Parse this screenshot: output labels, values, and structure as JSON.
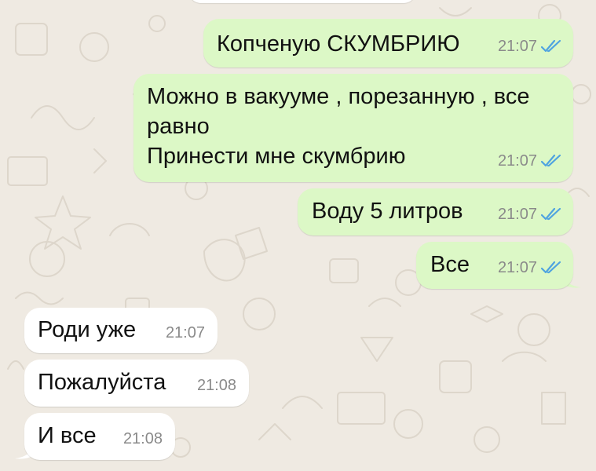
{
  "chat": {
    "outgoing": [
      {
        "lines": [
          "Копченую СКУМБРИЮ"
        ],
        "time": "21:07",
        "status": "read"
      },
      {
        "lines": [
          "Можно в вакууме , порезанную , все",
          "равно",
          "Принести мне скумбрию"
        ],
        "time": "21:07",
        "status": "read"
      },
      {
        "lines": [
          "Воду 5 литров"
        ],
        "time": "21:07",
        "status": "read"
      },
      {
        "lines": [
          "Все"
        ],
        "time": "21:07",
        "status": "read"
      }
    ],
    "incoming": [
      {
        "text": "Роди уже",
        "time": "21:07"
      },
      {
        "text": "Пожалуйста",
        "time": "21:08"
      },
      {
        "text": "И все",
        "time": "21:08"
      }
    ]
  },
  "colors": {
    "background": "#efeae2",
    "outgoing_bubble": "#dcf8c6",
    "incoming_bubble": "#ffffff",
    "read_ticks": "#4fa3e0",
    "timestamp": "#8a8a8a"
  },
  "icons": {
    "read_status": "double-check-icon",
    "wallpaper": "doodle-pattern"
  }
}
